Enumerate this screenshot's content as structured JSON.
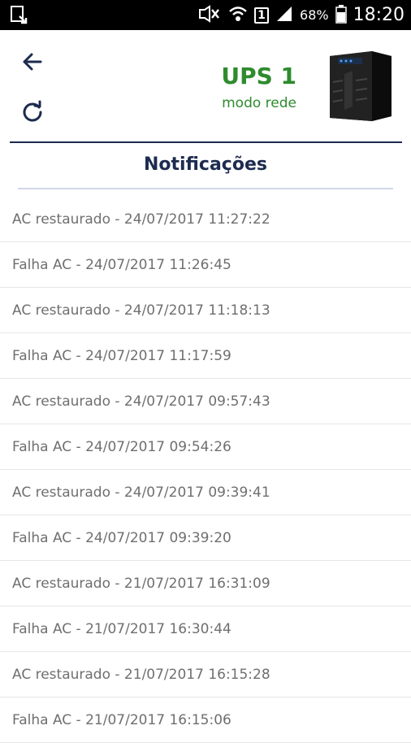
{
  "status_bar": {
    "battery_pct": "68%",
    "sim_slot": "1",
    "time": "18:20",
    "icons": [
      "download-icon",
      "mute-icon",
      "wifi-icon",
      "sim-icon",
      "signal-icon",
      "battery-icon"
    ]
  },
  "header": {
    "title": "UPS 1",
    "mode": "modo rede",
    "back_icon": "arrow-left-icon",
    "refresh_icon": "refresh-icon",
    "title_color": "#2e8b2e"
  },
  "section": {
    "title": "Notificações"
  },
  "notifications": [
    "AC restaurado - 24/07/2017 11:27:22",
    "Falha AC - 24/07/2017 11:26:45",
    "AC restaurado - 24/07/2017 11:18:13",
    "Falha AC - 24/07/2017 11:17:59",
    "AC restaurado - 24/07/2017 09:57:43",
    "Falha AC - 24/07/2017 09:54:26",
    "AC restaurado - 24/07/2017 09:39:41",
    "Falha AC - 24/07/2017 09:39:20",
    "AC restaurado - 21/07/2017 16:31:09",
    "Falha AC - 21/07/2017 16:30:44",
    "AC restaurado - 21/07/2017 16:15:28",
    "Falha AC - 21/07/2017 16:15:06"
  ]
}
